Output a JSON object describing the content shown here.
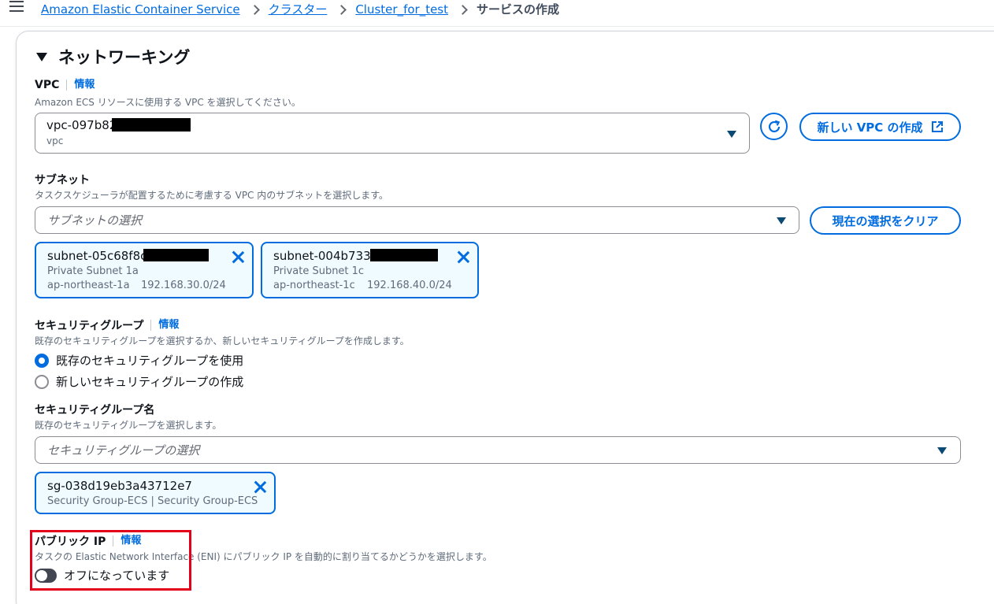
{
  "breadcrumb": {
    "items": [
      "Amazon Elastic Container Service",
      "クラスター",
      "Cluster_for_test"
    ],
    "current": "サービスの作成"
  },
  "section": {
    "title": "ネットワーキング"
  },
  "vpc": {
    "label": "VPC",
    "info": "情報",
    "description": "Amazon ECS リソースに使用する VPC を選択してください。",
    "value": "vpc-097b82",
    "sub": "vpc",
    "create_button": "新しい VPC の作成"
  },
  "subnet": {
    "label": "サブネット",
    "description": "タスクスケジューラが配置するために考慮する VPC 内のサブネットを選択します。",
    "placeholder": "サブネットの選択",
    "clear_button": "現在の選択をクリア",
    "tokens": [
      {
        "name": "subnet-05c68f8c",
        "line1": "Private Subnet 1a",
        "az": "ap-northeast-1a",
        "cidr": "192.168.30.0/24"
      },
      {
        "name": "subnet-004b7335",
        "line1": "Private Subnet 1c",
        "az": "ap-northeast-1c",
        "cidr": "192.168.40.0/24"
      }
    ]
  },
  "security_group": {
    "label": "セキュリティグループ",
    "info": "情報",
    "description": "既存のセキュリティグループを選択するか、新しいセキュリティグループを作成します。",
    "options": [
      "既存のセキュリティグループを使用",
      "新しいセキュリティグループの作成"
    ],
    "selected": "既存のセキュリティグループを使用"
  },
  "security_group_name": {
    "label": "セキュリティグループ名",
    "description": "既存のセキュリティグループを選択します。",
    "placeholder": "セキュリティグループの選択",
    "token": {
      "name": "sg-038d19eb3a43712e7",
      "line1": "Security Group-ECS | Security Group-ECS"
    }
  },
  "public_ip": {
    "label": "パブリック IP",
    "info": "情報",
    "description": "タスクの Elastic Network Interface (ENI) にパブリック IP を自動的に割り当てるかどうかを選択します。",
    "toggle_label": "オフになっています",
    "enabled": false
  },
  "colors": {
    "link": "#006ce0",
    "highlight": "#e3001b",
    "text": "#0f141a"
  }
}
